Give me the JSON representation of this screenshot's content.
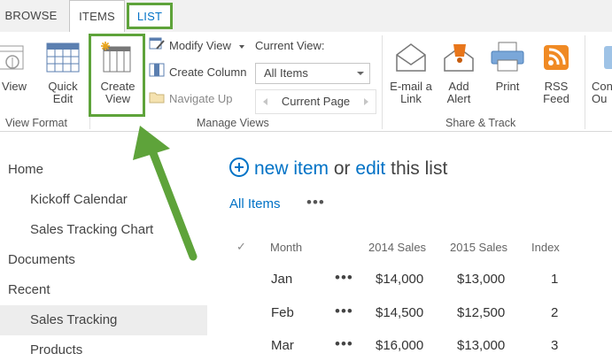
{
  "tabs": [
    {
      "label": "BROWSE"
    },
    {
      "label": "ITEMS"
    },
    {
      "label": "LIST"
    }
  ],
  "ribbon": {
    "view_format": {
      "view_label": "View",
      "quick_edit": [
        "Quick",
        "Edit"
      ],
      "group": "View Format"
    },
    "manage_views": {
      "create_view": [
        "Create",
        "View"
      ],
      "modify_view": "Modify View",
      "create_column": "Create Column",
      "navigate_up": "Navigate Up",
      "current_view_label": "Current View:",
      "current_view_value": "All Items",
      "current_page": "Current Page",
      "group": "Manage Views"
    },
    "share_track": {
      "email_link": [
        "E-mail a",
        "Link"
      ],
      "add_alert": [
        "Add",
        "Alert"
      ],
      "print": "Print",
      "rss_feed": [
        "RSS",
        "Feed"
      ],
      "group": "Share & Track"
    },
    "connect": [
      "Con",
      "Ou"
    ]
  },
  "nav": [
    {
      "label": "Home",
      "level": "top"
    },
    {
      "label": "Kickoff Calendar",
      "level": "sub"
    },
    {
      "label": "Sales Tracking Chart",
      "level": "sub"
    },
    {
      "label": "Documents",
      "level": "top"
    },
    {
      "label": "Recent",
      "level": "top"
    },
    {
      "label": "Sales Tracking",
      "level": "sub",
      "selected": true
    },
    {
      "label": "Products",
      "level": "sub"
    }
  ],
  "main": {
    "new_item": "new item",
    "or": "or",
    "edit": "edit",
    "this_list": "this list",
    "view_name": "All Items",
    "more": "•••",
    "columns": {
      "check": "✓",
      "month": "Month",
      "sales_2014": "2014 Sales",
      "sales_2015": "2015 Sales",
      "index": "Index"
    },
    "rows": [
      {
        "month": "Jan",
        "s2014": "$14,000",
        "s2015": "$13,000",
        "index": "1"
      },
      {
        "month": "Feb",
        "s2014": "$14,500",
        "s2015": "$12,500",
        "index": "2"
      },
      {
        "month": "Mar",
        "s2014": "$16,000",
        "s2015": "$13,000",
        "index": "3"
      }
    ]
  },
  "colors": {
    "accent": "#0072c6",
    "highlight": "#5ea33a"
  }
}
